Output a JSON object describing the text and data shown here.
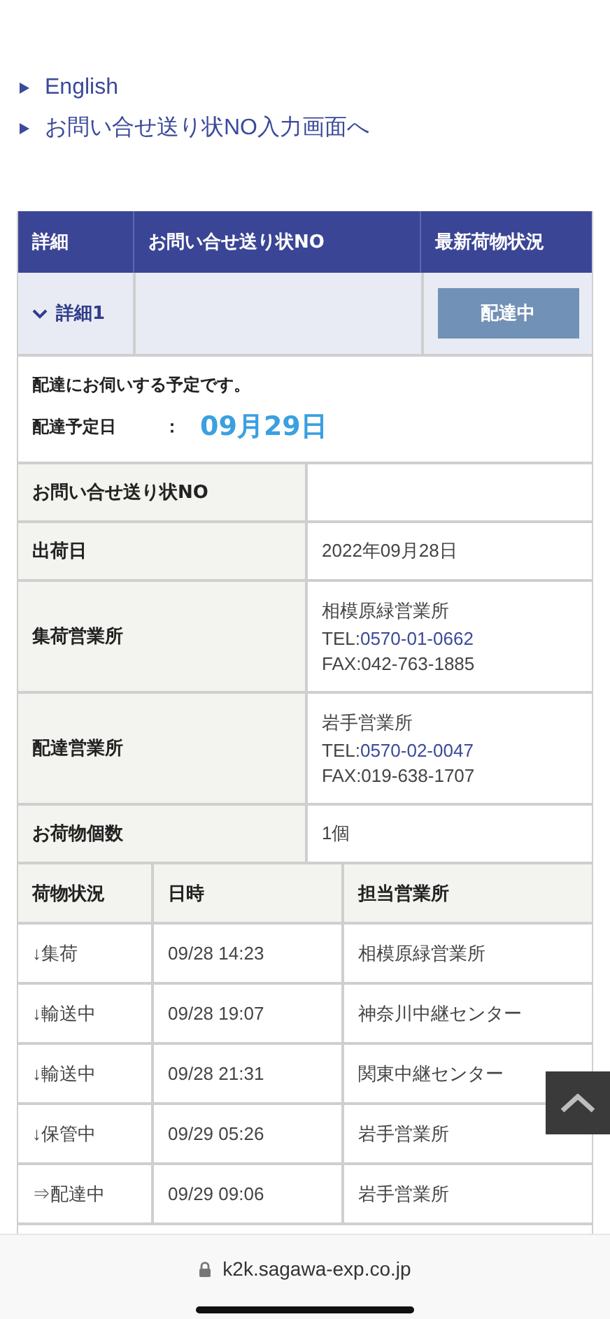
{
  "links": [
    {
      "label": "English"
    },
    {
      "label": "お問い合せ送り状NO入力画面へ"
    }
  ],
  "summary": {
    "columns": [
      "詳細",
      "お問い合せ送り状NO",
      "最新荷物状況"
    ],
    "detail_toggle": {
      "label": "詳細1",
      "expanded": true
    },
    "status_badge": "配達中"
  },
  "notice": {
    "message": "配達にお伺いする予定です。",
    "eta_label": "配達予定日",
    "separator": "：",
    "eta": "09月29日"
  },
  "details": [
    {
      "kind": "text",
      "label": "お問い合せ送り状NO"
    },
    {
      "kind": "text",
      "label": "出荷日",
      "value": "2022年09月28日"
    },
    {
      "kind": "office",
      "label": "集荷営業所",
      "office": "相模原緑営業所",
      "tel_label": "TEL:",
      "tel": "0570-01-0662",
      "fax": "FAX:042-763-1885"
    },
    {
      "kind": "office",
      "label": "配達営業所",
      "office": "岩手営業所",
      "tel_label": "TEL:",
      "tel": "0570-02-0047",
      "fax": "FAX:019-638-1707"
    },
    {
      "kind": "text",
      "label": "お荷物個数",
      "value": "1個"
    }
  ],
  "history": {
    "columns": [
      "荷物状況",
      "日時",
      "担当営業所"
    ],
    "rows": [
      [
        "↓集荷",
        "09/28 14:23",
        "相模原緑営業所"
      ],
      [
        "↓輸送中",
        "09/28 19:07",
        "神奈川中継センター"
      ],
      [
        "↓輸送中",
        "09/28 21:31",
        "関東中継センター"
      ],
      [
        "↓保管中",
        "09/29 05:26",
        "岩手営業所"
      ],
      [
        "⇒配達中",
        "09/29 09:06",
        "岩手営業所"
      ]
    ]
  },
  "address_bar": {
    "url": "k2k.sagawa-exp.co.jp"
  }
}
